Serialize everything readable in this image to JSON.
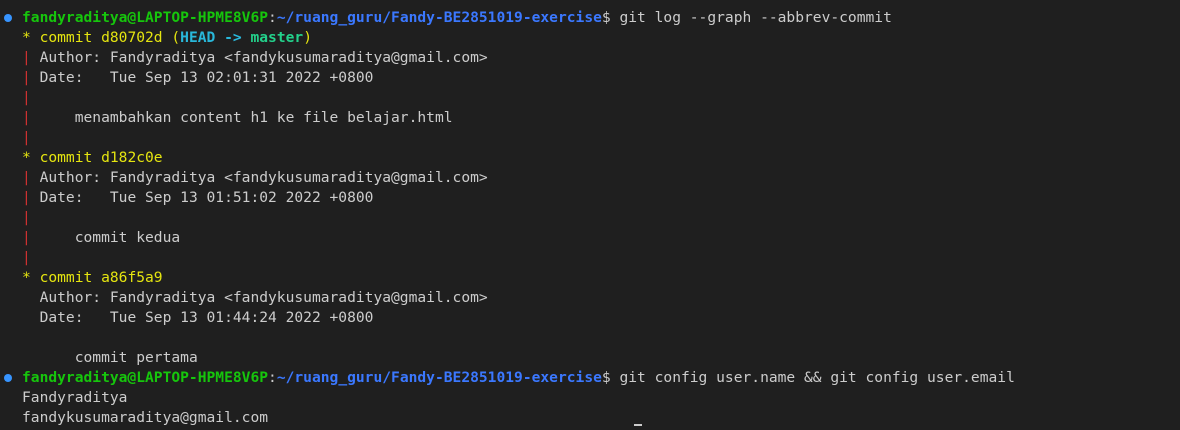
{
  "prompt": {
    "user_host": "fandyraditya@LAPTOP-HPME8V6P",
    "colon": ":",
    "path": "~/ruang_guru/Fandy-BE2851019-exercise",
    "dollar": "$ "
  },
  "commands": {
    "first": "git log --graph --abbrev-commit",
    "second": "git config user.name && git config user.email"
  },
  "commits": [
    {
      "star": "* ",
      "label": "commit d80702d ",
      "open_paren": "(",
      "head": "HEAD -> ",
      "branch": "master",
      "close_paren": ")",
      "author": "Author: Fandyraditya <fandykusumaraditya@gmail.com>",
      "date": "Date:   Tue Sep 13 02:01:31 2022 +0800",
      "message": "    menambahkan content h1 ke file belajar.html"
    },
    {
      "star": "* ",
      "label": "commit d182c0e",
      "author": "Author: Fandyraditya <fandykusumaraditya@gmail.com>",
      "date": "Date:   Tue Sep 13 01:51:02 2022 +0800",
      "message": "    commit kedua"
    },
    {
      "star": "* ",
      "label": "commit a86f5a9",
      "author": "Author: Fandyraditya <fandykusumaraditya@gmail.com>",
      "date": "Date:   Tue Sep 13 01:44:24 2022 +0800",
      "message": "    commit pertama"
    }
  ],
  "graph_bar": "| ",
  "graph_space": "  ",
  "output": {
    "name": "Fandyraditya",
    "email": "fandykusumaraditya@gmail.com"
  },
  "colors": {
    "background": "#1f1f1f",
    "prompt_user": "#16c60c",
    "prompt_path": "#3b78ff",
    "commit_yellow": "#e5e510",
    "head_ref": "#29b8db",
    "branch_ref": "#23d18b",
    "graph_line": "#cd3131",
    "status_dot": "#3794ff"
  }
}
